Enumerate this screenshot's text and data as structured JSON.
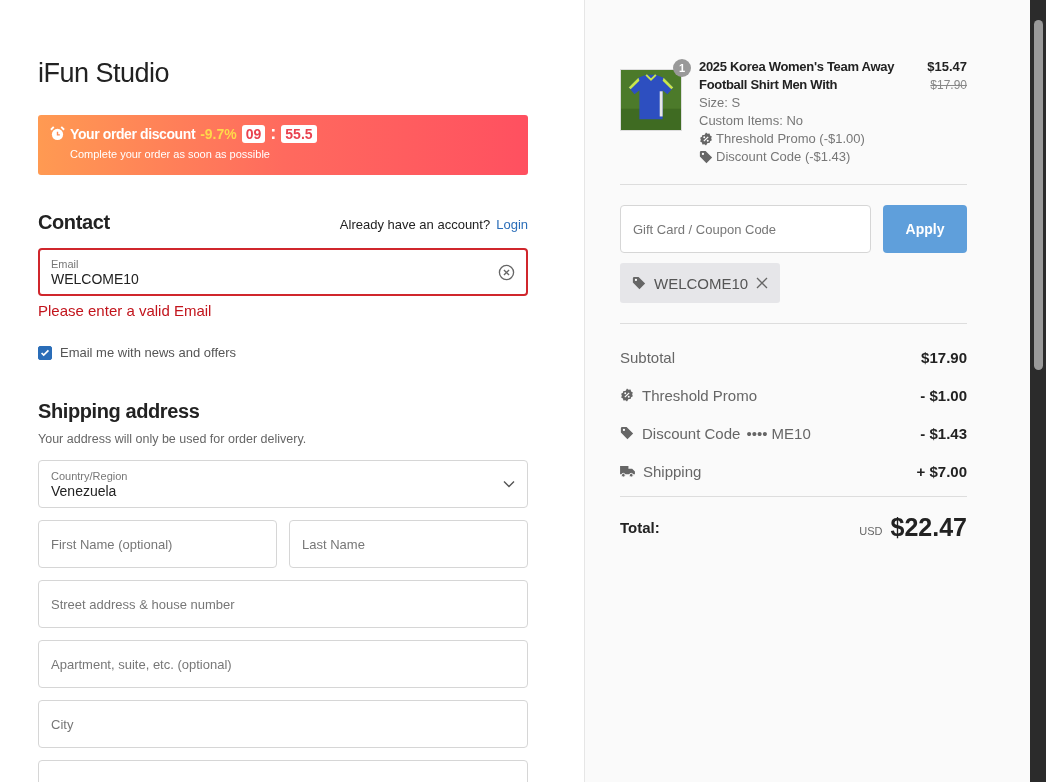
{
  "store": {
    "name": "iFun Studio"
  },
  "discount_banner": {
    "label": "Your order discount",
    "percent": "-9.7%",
    "minutes": "09",
    "separator": ":",
    "seconds": "55.5",
    "subtitle": "Complete your order as soon as possible"
  },
  "contact": {
    "heading": "Contact",
    "account_prompt": "Already have an account?",
    "login_link": "Login",
    "email": {
      "label": "Email",
      "value": "WELCOME10",
      "invalid": true
    },
    "error": "Please enter a valid Email",
    "newsletter": {
      "label": "Email me with news and offers",
      "checked": true
    }
  },
  "shipping": {
    "heading": "Shipping address",
    "note": "Your address will only be used for order delivery.",
    "country": {
      "label": "Country/Region",
      "value": "Venezuela"
    },
    "field_rows": [
      [
        {
          "placeholder": "First Name (optional)"
        },
        {
          "placeholder": "Last Name"
        }
      ],
      [
        {
          "placeholder": "Street address & house number"
        }
      ],
      [
        {
          "placeholder": "Apartment, suite, etc. (optional)"
        }
      ],
      [
        {
          "placeholder": "City"
        }
      ]
    ],
    "more_fields_below": true
  },
  "order": {
    "item": {
      "quantity": "1",
      "title": "2025 Korea Women's Team Away Football Shirt Men With",
      "price": "$15.47",
      "original_price": "$17.90",
      "details": [
        "Size: S",
        "Custom Items: No"
      ],
      "discounts": [
        {
          "kind": "promo",
          "text": "Threshold Promo (-$1.00)"
        },
        {
          "kind": "code",
          "text": "Discount Code (-$1.43)"
        }
      ]
    },
    "coupon": {
      "placeholder": "Gift Card / Coupon Code",
      "button": "Apply",
      "applied_code": "WELCOME10"
    },
    "summary": [
      {
        "kind": "plain",
        "label": "Subtotal",
        "value": "$17.90"
      },
      {
        "kind": "promo",
        "label": "Threshold Promo",
        "value": "- $1.00"
      },
      {
        "kind": "code",
        "label": "Discount Code",
        "code": "•••• ME10",
        "value": "- $1.43"
      },
      {
        "kind": "shipping",
        "label": "Shipping",
        "value": "+ $7.00"
      }
    ],
    "total": {
      "label": "Total:",
      "currency": "USD",
      "amount": "$22.47"
    }
  }
}
